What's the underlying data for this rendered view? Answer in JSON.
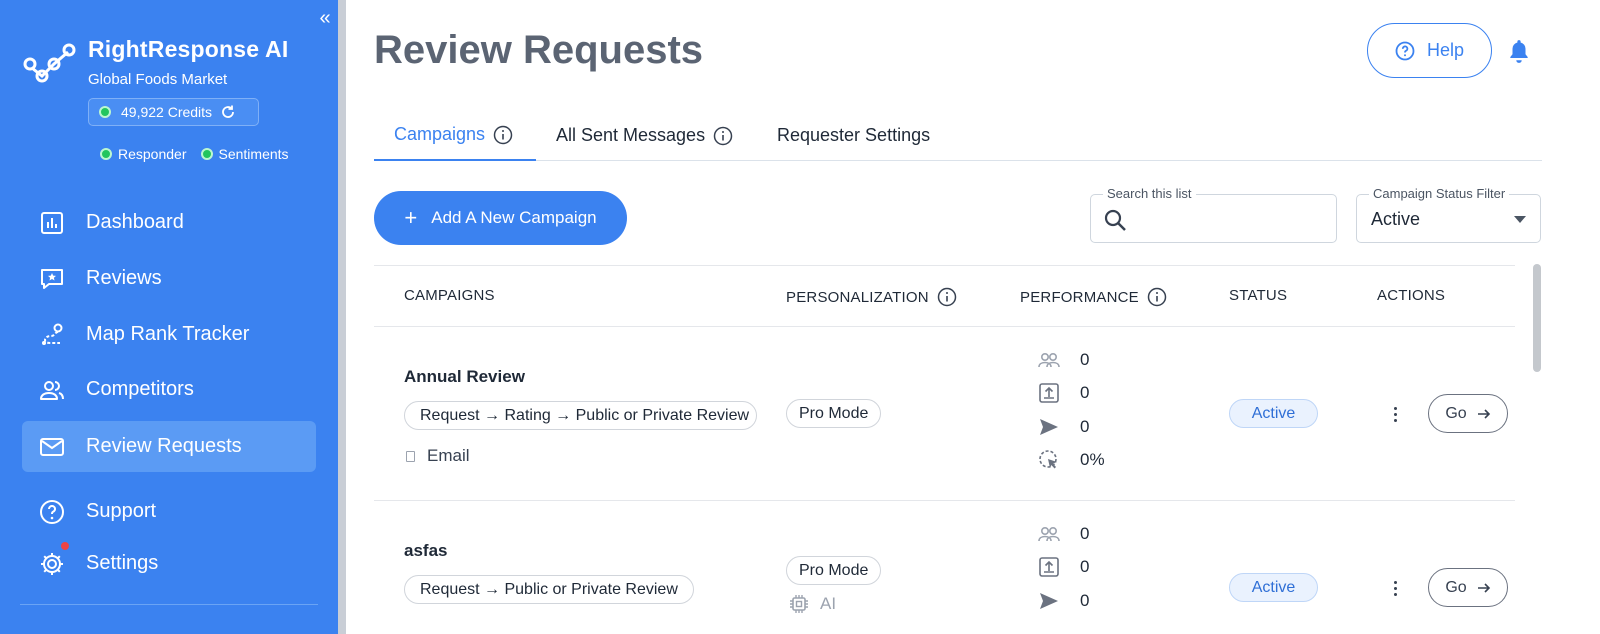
{
  "sidebar": {
    "brand_name": "RightResponse AI",
    "business": "Global Foods Market",
    "credits": "49,922 Credits",
    "statuses": [
      {
        "label": "Responder",
        "color": "#22c55e"
      },
      {
        "label": "Sentiments",
        "color": "#22c55e"
      }
    ],
    "items": [
      {
        "label": "Dashboard",
        "icon": "chart-icon"
      },
      {
        "label": "Reviews",
        "icon": "review-chat-icon"
      },
      {
        "label": "Map Rank Tracker",
        "icon": "route-icon"
      },
      {
        "label": "Competitors",
        "icon": "users-icon"
      },
      {
        "label": "Review Requests",
        "icon": "mail-icon",
        "active": true
      },
      {
        "label": "Support",
        "icon": "question-icon"
      },
      {
        "label": "Settings",
        "icon": "gear-icon",
        "notification": true
      }
    ],
    "accent": "#3b82f0"
  },
  "header": {
    "title": "Review Requests",
    "help_label": "Help"
  },
  "tabs": [
    {
      "label": "Campaigns",
      "active": true
    },
    {
      "label": "All Sent Messages"
    },
    {
      "label": "Requester Settings"
    }
  ],
  "toolbar": {
    "add_label": "Add A New Campaign",
    "search_label": "Search this list",
    "search_value": "",
    "filter_label": "Campaign Status Filter",
    "filter_value": "Active"
  },
  "table": {
    "columns": [
      "CAMPAIGNS",
      "PERSONALIZATION",
      "PERFORMANCE",
      "STATUS",
      "ACTIONS"
    ],
    "rows": [
      {
        "name": "Annual Review",
        "flow": "Request → Rating → Public or Private Review",
        "channel": "Email",
        "mode": "Pro Mode",
        "ai": "",
        "metrics": [
          "0",
          "0",
          "0",
          "0%"
        ],
        "status": "Active",
        "action": "Go"
      },
      {
        "name": "asfas",
        "flow": "Request → Public or Private Review",
        "channel": "",
        "mode": "Pro Mode",
        "ai": "AI",
        "metrics": [
          "0",
          "0",
          "0"
        ],
        "status": "Active",
        "action": "Go"
      }
    ]
  }
}
